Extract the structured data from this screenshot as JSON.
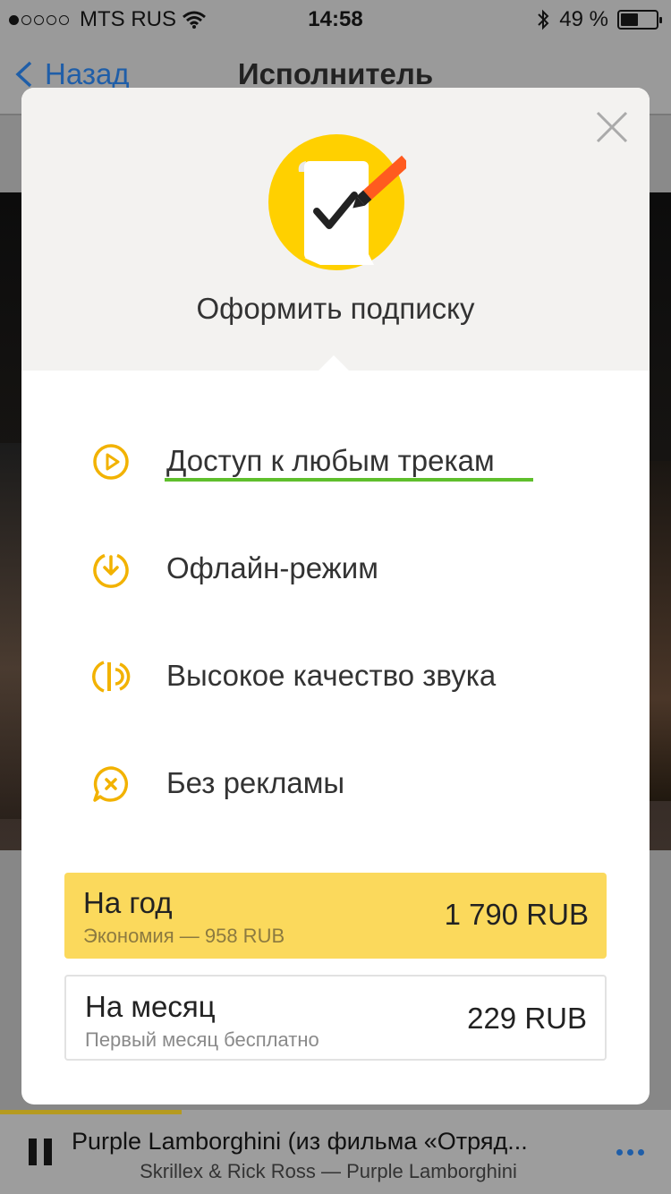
{
  "status_bar": {
    "carrier": "MTS RUS",
    "time": "14:58",
    "battery_percent": "49 %",
    "battery_level": 0.49
  },
  "nav": {
    "back_label": "Назад",
    "title": "Исполнитель"
  },
  "modal": {
    "title": "Оформить подписку",
    "features": [
      {
        "label": "Доступ к любым трекам",
        "icon": "play-circle-icon"
      },
      {
        "label": "Офлайн-режим",
        "icon": "download-circle-icon"
      },
      {
        "label": "Высокое качество звука",
        "icon": "sound-quality-icon"
      },
      {
        "label": "Без рекламы",
        "icon": "no-ads-icon"
      }
    ],
    "plans": [
      {
        "name": "На год",
        "note": "Экономия — 958 RUB",
        "price": "1 790 RUB"
      },
      {
        "name": "На месяц",
        "note": "Первый месяц бесплатно",
        "price": "229 RUB"
      }
    ]
  },
  "player": {
    "track": "Purple Lamborghini (из фильма «Отряд...",
    "artist": "Skrillex & Rick Ross — Purple Lamborghini",
    "progress": 0.27
  },
  "colors": {
    "accent_yellow": "#fbd95c",
    "icon_orange": "#f2b200",
    "link_blue": "#1f5ea8",
    "underline_green": "#5fbf2c"
  }
}
